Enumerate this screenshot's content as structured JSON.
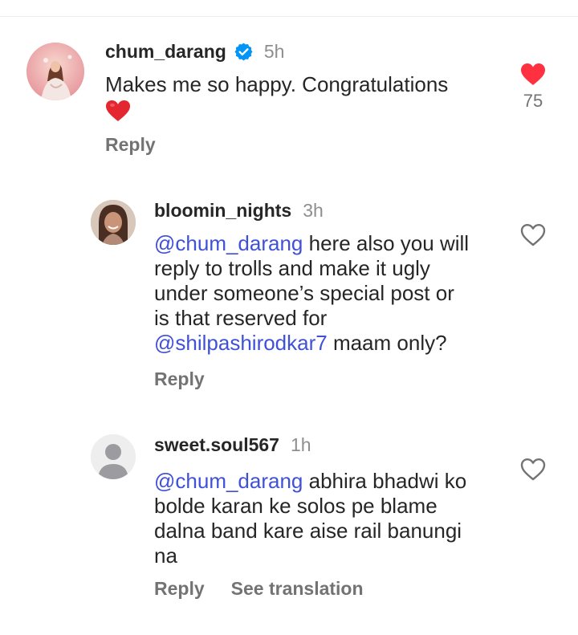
{
  "comments": [
    {
      "username": "chum_darang",
      "verified": true,
      "time": "5h",
      "text": "Makes me so happy. Congratulations",
      "emoji": "❤️",
      "liked": true,
      "like_count": "75",
      "actions": [
        "Reply"
      ]
    },
    {
      "username": "bloomin_nights",
      "time": "3h",
      "lines": [
        {
          "mention": "@chum_darang",
          "text": " here also you will"
        },
        {
          "text": "reply to trolls and make it ugly"
        },
        {
          "text": "under someone’s special post or"
        },
        {
          "text": "is that reserved for"
        },
        {
          "mention": "@shilpashirodkar7",
          "text": " maam only?"
        }
      ],
      "liked": false,
      "actions": [
        "Reply"
      ]
    },
    {
      "username": "sweet.soul567",
      "time": "1h",
      "lines": [
        {
          "mention": "@chum_darang",
          "text": " abhira bhadwi ko"
        },
        {
          "text": "bolde karan ke solos pe blame"
        },
        {
          "text": "dalna band kare aise rail banungi"
        },
        {
          "text": "na"
        }
      ],
      "liked": false,
      "actions": [
        "Reply",
        "See translation"
      ]
    }
  ],
  "colors": {
    "mention": "#3f51d6",
    "like_active": "#ff3040",
    "verified": "#0095f6",
    "secondary_text": "#737373"
  },
  "icons": {
    "verified": "verified-badge-icon",
    "like_filled": "heart-filled-icon",
    "like_outline": "heart-outline-icon",
    "default_avatar": "default-user-icon"
  }
}
